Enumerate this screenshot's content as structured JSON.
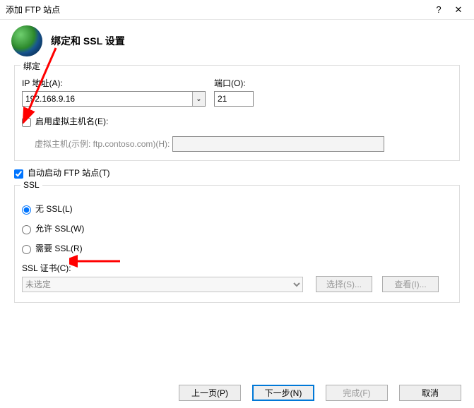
{
  "window": {
    "title": "添加 FTP 站点"
  },
  "header": {
    "title": "绑定和 SSL 设置"
  },
  "binding": {
    "section_label": "绑定",
    "ip_label": "IP 地址(A):",
    "ip_value": "192.168.9.16",
    "port_label": "端口(O):",
    "port_value": "21",
    "vhost_check": "启用虚拟主机名(E):",
    "vhost_label": "虚拟主机(示例: ftp.contoso.com)(H):",
    "vhost_value": ""
  },
  "autostart": "自动启动 FTP 站点(T)",
  "ssl": {
    "section_label": "SSL",
    "no_ssl": "无 SSL(L)",
    "allow_ssl": "允许 SSL(W)",
    "require_ssl": "需要 SSL(R)",
    "cert_label": "SSL 证书(C):",
    "cert_value": "未选定",
    "select_btn": "选择(S)...",
    "view_btn": "查看(I)..."
  },
  "footer": {
    "prev": "上一页(P)",
    "next": "下一步(N)",
    "finish": "完成(F)",
    "cancel": "取消"
  }
}
